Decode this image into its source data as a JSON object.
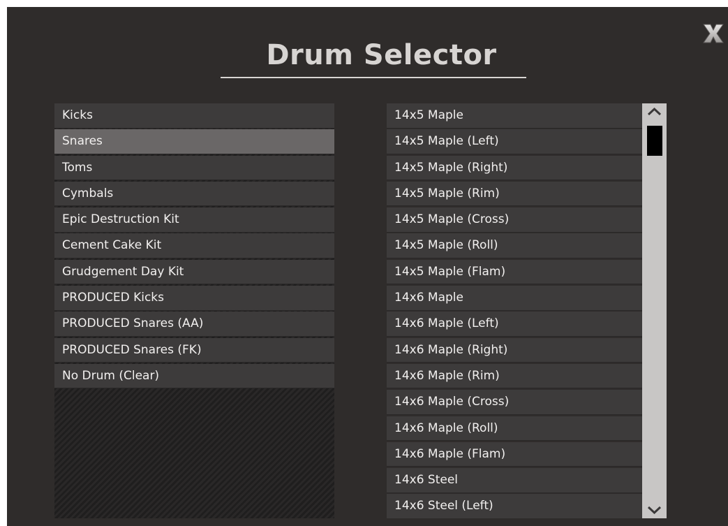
{
  "window": {
    "title": "Drum Selector",
    "close_label": "X"
  },
  "categories": {
    "selected_index": 1,
    "items": [
      {
        "label": "Kicks"
      },
      {
        "label": "Snares"
      },
      {
        "label": "Toms"
      },
      {
        "label": "Cymbals"
      },
      {
        "label": "Epic Destruction Kit"
      },
      {
        "label": "Cement Cake Kit"
      },
      {
        "label": "Grudgement Day Kit"
      },
      {
        "label": "PRODUCED Kicks"
      },
      {
        "label": "PRODUCED Snares (AA)"
      },
      {
        "label": "PRODUCED Snares (FK)"
      },
      {
        "label": "No Drum (Clear)"
      }
    ]
  },
  "drums": {
    "items": [
      {
        "label": "14x5 Maple"
      },
      {
        "label": "14x5 Maple (Left)"
      },
      {
        "label": "14x5 Maple (Right)"
      },
      {
        "label": "14x5 Maple (Rim)"
      },
      {
        "label": "14x5 Maple (Cross)"
      },
      {
        "label": "14x5 Maple (Roll)"
      },
      {
        "label": "14x5 Maple (Flam)"
      },
      {
        "label": "14x6 Maple"
      },
      {
        "label": "14x6 Maple (Left)"
      },
      {
        "label": "14x6 Maple (Right)"
      },
      {
        "label": "14x6 Maple (Rim)"
      },
      {
        "label": "14x6 Maple (Cross)"
      },
      {
        "label": "14x6 Maple (Roll)"
      },
      {
        "label": "14x6 Maple (Flam)"
      },
      {
        "label": "14x6 Steel"
      },
      {
        "label": "14x6 Steel (Left)"
      }
    ],
    "scrollbar": {
      "scroll_position": 0.0
    }
  },
  "icons": {
    "close": "close-icon",
    "scroll_up": "chevron-up-icon",
    "scroll_down": "chevron-down-icon"
  },
  "colors": {
    "background": "#2f2c2b",
    "row": "#3d3b3b",
    "row_selected": "#6a6767",
    "text": "#f2f0ef",
    "scrollbar_track": "#c8c6c5",
    "scrollbar_thumb": "#000000"
  }
}
